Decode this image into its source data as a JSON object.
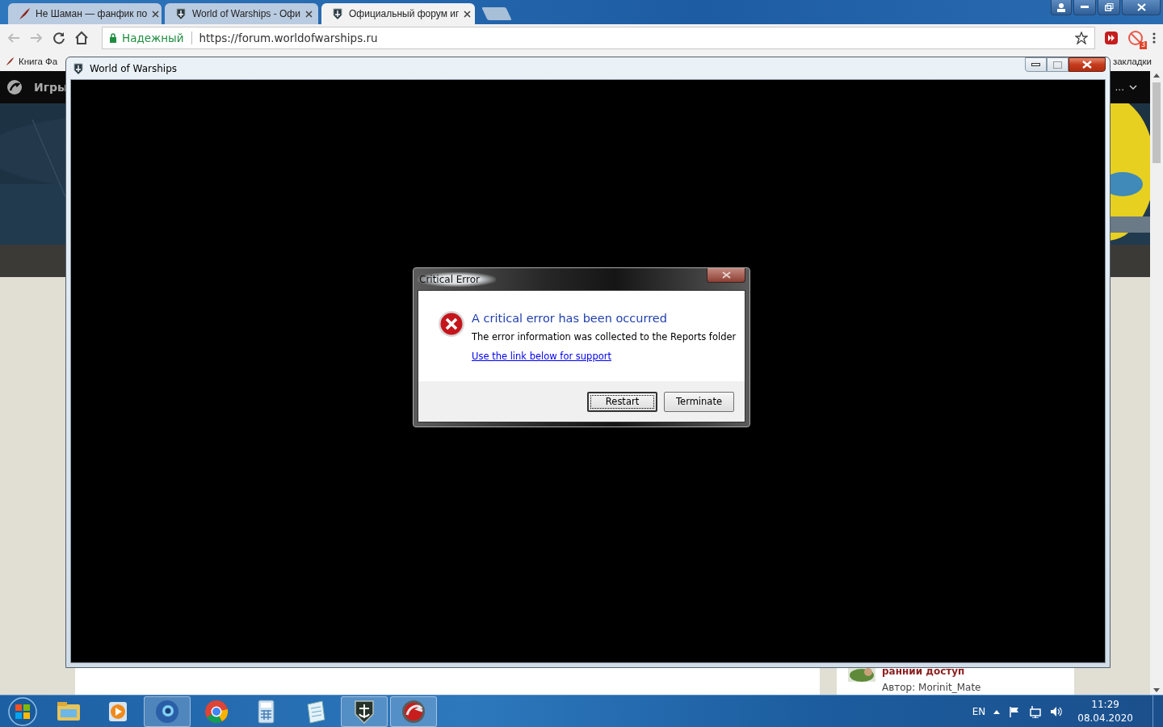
{
  "browser": {
    "tabs": [
      {
        "title": "Не Шаман — фанфик по",
        "kind": "feather",
        "selected": false
      },
      {
        "title": "World of Warships - Офи",
        "kind": "shield",
        "selected": false
      },
      {
        "title": "Официальный форум иг",
        "kind": "shield",
        "selected": true
      }
    ],
    "address": {
      "security_label": "Надежный",
      "url": "https://forum.worldofwarships.ru"
    },
    "extension_badge": "3",
    "bookmarks": [
      {
        "title": "Книга Фа"
      }
    ],
    "bookmarks_more": "закладки"
  },
  "site": {
    "nav_label": "Игры",
    "nav_more": "...",
    "news": [
      {
        "title": "раннии доступ",
        "author": "Автор: Morinit_Mate"
      }
    ]
  },
  "game_window": {
    "title": "World of Warships"
  },
  "dialog": {
    "title": "Critical Error",
    "heading": "A critical error has been occurred",
    "message": "The error information was collected to the Reports folder",
    "link": "Use the link below for support",
    "buttons": [
      {
        "label": "Restart",
        "focused": true
      },
      {
        "label": "Terminate",
        "focused": false
      }
    ]
  },
  "taskbar": {
    "apps": [
      {
        "kind": "explorer",
        "active": false
      },
      {
        "kind": "player",
        "active": false
      },
      {
        "kind": "browser",
        "active": true
      },
      {
        "kind": "chrome",
        "active": false
      },
      {
        "kind": "calculator",
        "active": false
      },
      {
        "kind": "notepad",
        "active": false
      },
      {
        "kind": "shield",
        "active": true
      },
      {
        "kind": "game",
        "active": true
      }
    ],
    "language": "EN",
    "time": "11:29",
    "date": "08.04.2020"
  }
}
